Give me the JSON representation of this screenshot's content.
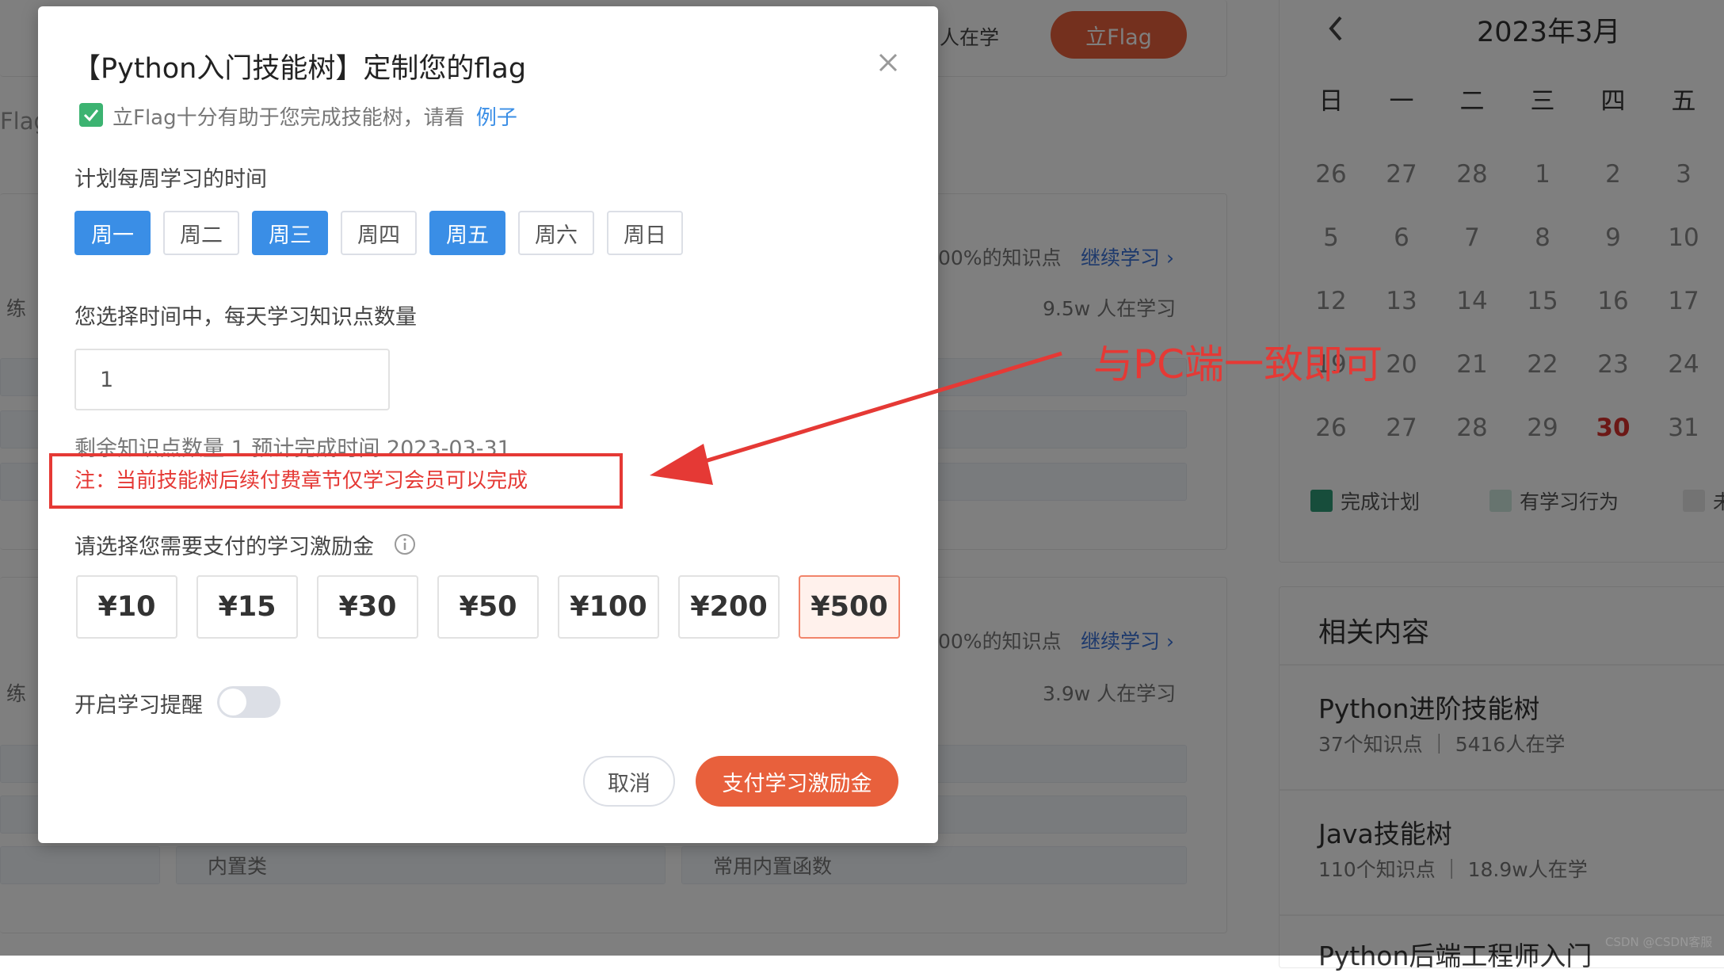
{
  "background": {
    "header_learners": "人在学",
    "flag_button": "立Flag",
    "side_flag": "Flag",
    "side_practice_1": "练",
    "side_practice_2": "练",
    "progress_text_1": "00%的知识点",
    "continue_1": "继续学习 ›",
    "learners_1": "9.5w 人在学习",
    "progress_text_2": "00%的知识点",
    "continue_2": "继续学习 ›",
    "learners_2": "3.9w 人在学习",
    "chip_builtin": "内置类",
    "chip_builtin_func": "常用内置函数"
  },
  "calendar": {
    "prev_icon": "chevron-left-icon",
    "month_title": "2023年3月",
    "weekdays": [
      "日",
      "一",
      "二",
      "三",
      "四",
      "五"
    ],
    "rows": [
      [
        "26",
        "27",
        "28",
        "1",
        "2",
        "3"
      ],
      [
        "5",
        "6",
        "7",
        "8",
        "9",
        "10"
      ],
      [
        "12",
        "13",
        "14",
        "15",
        "16",
        "17"
      ],
      [
        "19",
        "20",
        "21",
        "22",
        "23",
        "24"
      ],
      [
        "26",
        "27",
        "28",
        "29",
        "30",
        "31"
      ]
    ],
    "today": "30",
    "today_color": "#d9302c",
    "legend": [
      {
        "label": "完成计划",
        "color": "#2e9b77"
      },
      {
        "label": "有学习行为",
        "color": "#cfe9df"
      },
      {
        "label": "未",
        "color": "#e6e6e6"
      }
    ]
  },
  "related": {
    "title": "相关内容",
    "items": [
      {
        "title": "Python进阶技能树",
        "meta": "37个知识点 ｜ 5416人在学"
      },
      {
        "title": "Java技能树",
        "meta": "110个知识点 ｜ 18.9w人在学"
      },
      {
        "title": "Python后端工程师入门",
        "meta": ""
      }
    ]
  },
  "modal": {
    "title": "【Python入门技能树】定制您的flag",
    "close_icon": "close-icon",
    "hint_text": "立Flag十分有助于您完成技能树，请看",
    "hint_link": "例子",
    "hint_icon_color": "#3cb371",
    "week_label": "计划每周学习的时间",
    "days": [
      {
        "label": "周一",
        "selected": true
      },
      {
        "label": "周二",
        "selected": false
      },
      {
        "label": "周三",
        "selected": true
      },
      {
        "label": "周四",
        "selected": false
      },
      {
        "label": "周五",
        "selected": true
      },
      {
        "label": "周六",
        "selected": false
      },
      {
        "label": "周日",
        "selected": false
      }
    ],
    "count_label": "您选择时间中，每天学习知识点数量",
    "count_value": "1",
    "remaining_text": "剩余知识点数量 1 预计完成时间 2023-03-31",
    "note_text": "注：当前技能树后续付费章节仅学习会员可以完成",
    "amount_label": "请选择您需要支付的学习激励金",
    "info_icon": "info-icon",
    "amounts": [
      {
        "label": "¥10",
        "selected": false
      },
      {
        "label": "¥15",
        "selected": false
      },
      {
        "label": "¥30",
        "selected": false
      },
      {
        "label": "¥50",
        "selected": false
      },
      {
        "label": "¥100",
        "selected": false
      },
      {
        "label": "¥200",
        "selected": false
      },
      {
        "label": "¥500",
        "selected": true
      }
    ],
    "reminder_label": "开启学习提醒",
    "reminder_on": false,
    "cancel_label": "取消",
    "pay_label": "支付学习激励金"
  },
  "annotation": {
    "text": "与PC端一致即可",
    "color": "#e53935"
  },
  "watermark": "CSDN @CSDN客服"
}
